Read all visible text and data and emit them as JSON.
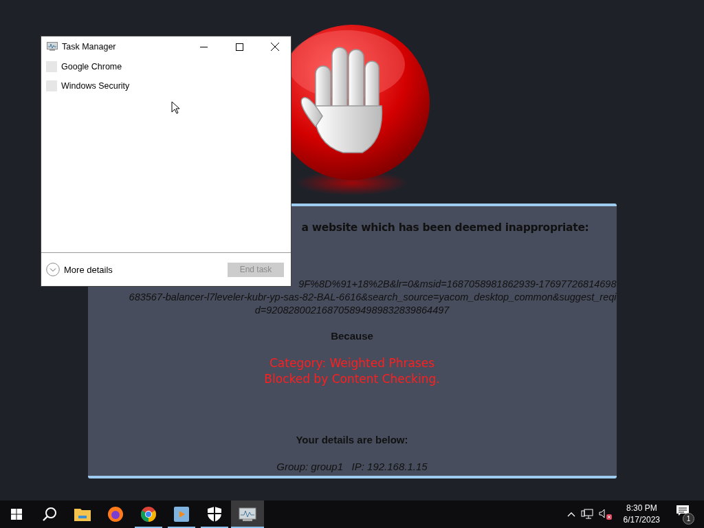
{
  "block_page": {
    "heading": "a website which has been deemed inappropriate:",
    "url_lines": [
      "9F%8D%91+18%2B&lr=0&msid=1687058981862939-17697726814698",
      "683567-balancer-l7leveler-kubr-yp-sas-82-BAL-6616&search_source=yacom_desktop_common&suggest_reqi",
      "d=920828002168705894989832839864497"
    ],
    "because": "Because",
    "reasons": [
      "Category: Weighted Phrases",
      "Blocked by Content Checking."
    ],
    "details_heading": "Your details are below:",
    "details": "Group: group1   IP: 192.168.1.15"
  },
  "task_manager": {
    "title": "Task Manager",
    "apps": [
      {
        "name": "Google Chrome"
      },
      {
        "name": "Windows Security"
      }
    ],
    "more_details": "More details",
    "end_task": {
      "label": "End task",
      "disabled": true
    }
  },
  "taskbar": {
    "apps": [
      {
        "kind": "explorer",
        "running": false,
        "selected": false
      },
      {
        "kind": "firefox",
        "running": false,
        "selected": false
      },
      {
        "kind": "chrome",
        "running": true,
        "selected": false
      },
      {
        "kind": "media",
        "running": true,
        "selected": false
      },
      {
        "kind": "shield",
        "running": true,
        "selected": false
      },
      {
        "kind": "taskmgr",
        "running": true,
        "selected": true
      }
    ],
    "time": "8:30 PM",
    "date": "6/17/2023",
    "notifications": "1"
  }
}
